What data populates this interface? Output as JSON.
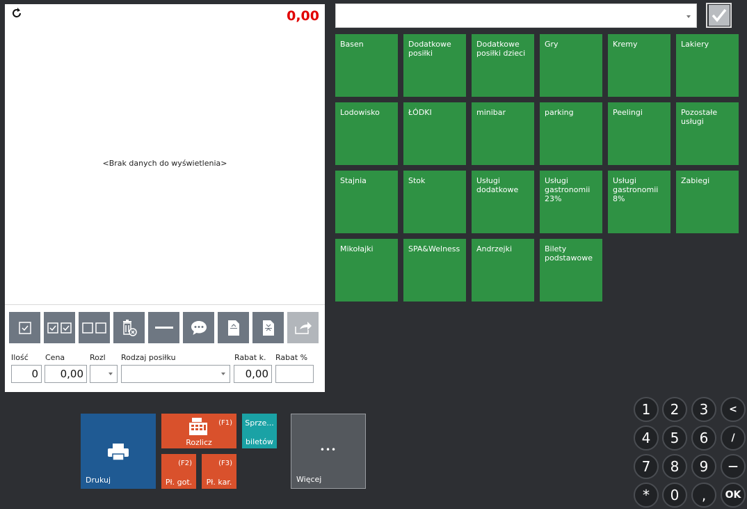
{
  "receipt": {
    "total": "0,00",
    "empty_message": "<Brak danych do wyświetlenia>"
  },
  "form": {
    "qty_label": "Ilość",
    "qty_value": "0",
    "price_label": "Cena",
    "price_value": "0,00",
    "rozl_label": "Rozl",
    "rozl_value": "",
    "meal_label": "Rodzaj posiłku",
    "meal_value": "",
    "discount_amount_label": "Rabat k.",
    "discount_amount_value": "0,00",
    "discount_percent_label": "Rabat %",
    "discount_percent_value": ""
  },
  "combo": {
    "value": ""
  },
  "categories": [
    "Basen",
    "Dodatkowe posiłki",
    "Dodatkowe posiłki dzieci",
    "Gry",
    "Kremy",
    "Lakiery",
    "Lodowisko",
    "ŁÓDKI",
    "minibar",
    "parking",
    "Peelingi",
    "Pozostałe usługi",
    "Stajnia",
    "Stok",
    "Usługi dodatkowe",
    "Usługi gastronomii 23%",
    "Usługi gastronomii 8%",
    "Zabiegi",
    "Mikołajki",
    "SPA&Welness",
    "Andrzejki",
    "Bilety podstawowe"
  ],
  "actions": {
    "print": "Drukuj",
    "settle": "Rozlicz",
    "settle_key": "(F1)",
    "sale_line1": "Sprze...",
    "sale_line2": "biletów",
    "cash": "Pł. got.",
    "cash_key": "(F2)",
    "card": "Pł. kar.",
    "card_key": "(F3)",
    "more_dots": "•••",
    "more": "Więcej"
  },
  "keypad": {
    "k1": "1",
    "k2": "2",
    "k3": "3",
    "back": "<",
    "k4": "4",
    "k5": "5",
    "k6": "6",
    "slash": "/",
    "k7": "7",
    "k8": "8",
    "k9": "9",
    "minus": "—",
    "star": "*",
    "k0": "0",
    "comma": ",",
    "ok": "OK"
  },
  "colors": {
    "tile": "#2f9244",
    "print": "#1f5a93",
    "settle": "#d9512c",
    "sale": "#1aa2a5",
    "total": "#e10000"
  }
}
